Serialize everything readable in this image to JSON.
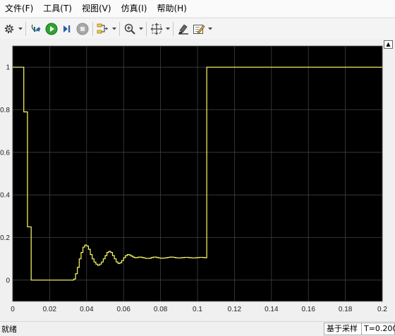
{
  "menu": {
    "items": [
      "文件(F)",
      "工具(T)",
      "视图(V)",
      "仿真(I)",
      "帮助(H)"
    ]
  },
  "toolbar": {
    "buttons": [
      {
        "name": "settings",
        "icon": "gear-icon"
      },
      {
        "name": "step-back",
        "icon": "step-back-icon"
      },
      {
        "name": "run",
        "icon": "run-icon"
      },
      {
        "name": "step-forward",
        "icon": "step-forward-icon"
      },
      {
        "name": "stop",
        "icon": "stop-icon"
      },
      {
        "name": "signal-selector",
        "icon": "signal-selector-icon"
      },
      {
        "name": "zoom",
        "icon": "zoom-icon"
      },
      {
        "name": "autoscale",
        "icon": "autoscale-icon"
      },
      {
        "name": "highlight",
        "icon": "highlight-icon"
      },
      {
        "name": "style",
        "icon": "style-icon"
      }
    ]
  },
  "status": {
    "left": "就绪",
    "sampling": "基于采样",
    "time": "T=0.200"
  },
  "colors": {
    "plot_bg": "#000000",
    "grid": "#404040",
    "trace": "#ffff66",
    "run_green": "#2fa52f"
  },
  "chart_data": {
    "type": "line",
    "step": true,
    "xlim": [
      0,
      0.2
    ],
    "ylim": [
      -0.1,
      1.1
    ],
    "xticks": [
      "0",
      "0.02",
      "0.04",
      "0.06",
      "0.08",
      "0.1",
      "0.12",
      "0.14",
      "0.16",
      "0.18",
      "0.2"
    ],
    "yticks": [
      "0",
      "0.2",
      "0.4",
      "0.6",
      "0.8",
      "1"
    ],
    "grid": true,
    "x": [
      0,
      0.006,
      0.008,
      0.01,
      0.033,
      0.034,
      0.035,
      0.036,
      0.037,
      0.038,
      0.039,
      0.04,
      0.041,
      0.042,
      0.043,
      0.044,
      0.045,
      0.046,
      0.047,
      0.048,
      0.049,
      0.05,
      0.051,
      0.052,
      0.053,
      0.054,
      0.055,
      0.056,
      0.057,
      0.058,
      0.059,
      0.06,
      0.061,
      0.062,
      0.063,
      0.064,
      0.065,
      0.066,
      0.067,
      0.068,
      0.069,
      0.07,
      0.071,
      0.072,
      0.073,
      0.074,
      0.075,
      0.076,
      0.077,
      0.078,
      0.079,
      0.08,
      0.081,
      0.082,
      0.083,
      0.084,
      0.085,
      0.086,
      0.087,
      0.088,
      0.089,
      0.09,
      0.091,
      0.092,
      0.093,
      0.094,
      0.095,
      0.096,
      0.097,
      0.098,
      0.099,
      0.1,
      0.101,
      0.102,
      0.103,
      0.104,
      0.105,
      0.2
    ],
    "y": [
      1,
      0.79,
      0.25,
      0,
      0.005,
      0.03,
      0.06,
      0.1,
      0.13,
      0.155,
      0.165,
      0.16,
      0.145,
      0.12,
      0.1,
      0.085,
      0.075,
      0.07,
      0.075,
      0.085,
      0.1,
      0.115,
      0.13,
      0.135,
      0.13,
      0.115,
      0.1,
      0.085,
      0.078,
      0.082,
      0.092,
      0.105,
      0.115,
      0.12,
      0.118,
      0.113,
      0.108,
      0.105,
      0.106,
      0.108,
      0.108,
      0.106,
      0.104,
      0.102,
      0.102,
      0.103,
      0.106,
      0.108,
      0.108,
      0.106,
      0.104,
      0.103,
      0.103,
      0.104,
      0.105,
      0.107,
      0.108,
      0.108,
      0.107,
      0.105,
      0.104,
      0.104,
      0.105,
      0.106,
      0.107,
      0.107,
      0.106,
      0.105,
      0.104,
      0.104,
      0.105,
      0.106,
      0.107,
      0.107,
      0.106,
      0.105,
      1,
      1
    ]
  }
}
